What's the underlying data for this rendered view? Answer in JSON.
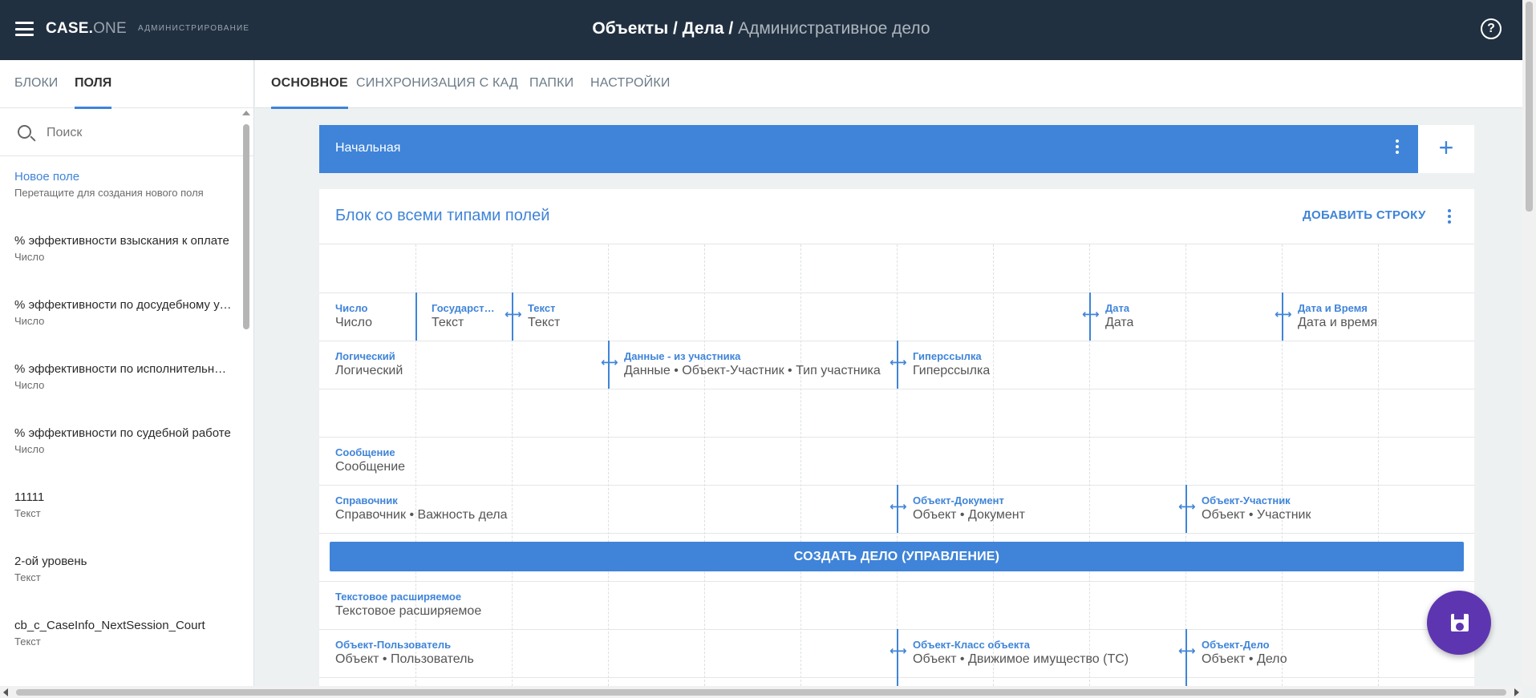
{
  "app": {
    "logo_main": "CASE.",
    "logo_one": "ONE",
    "section": "АДМИНИСТРИРОВАНИЕ",
    "breadcrumb_1": "Объекты",
    "breadcrumb_sep": " / ",
    "breadcrumb_2": "Дела",
    "breadcrumb_current": "Административное дело",
    "help_glyph": "?",
    "menu_icon": "hamburger-icon",
    "help_icon": "help-circle-icon"
  },
  "colors": {
    "topbar": "#213040",
    "accent": "#3f84d8",
    "fab": "#5e35b1"
  },
  "sidebar": {
    "tabs": [
      {
        "label": "БЛОКИ",
        "active": false
      },
      {
        "label": "ПОЛЯ",
        "active": true
      }
    ],
    "search_placeholder": "Поиск",
    "search_value": "",
    "items": [
      {
        "name": "Новое поле",
        "type": "Перетащите для создания нового поля"
      },
      {
        "name": "% эффективности взыскания к оплате",
        "type": "Число"
      },
      {
        "name": "% эффективности по досудебному урегулированию",
        "type": "Число"
      },
      {
        "name": "% эффективности по исполнительному производству",
        "type": "Число"
      },
      {
        "name": "% эффективности по судебной работе",
        "type": "Число"
      },
      {
        "name": "11111",
        "type": "Текст"
      },
      {
        "name": "2-ой уровень",
        "type": "Текст"
      },
      {
        "name": "cb_c_CaseInfo_NextSession_Court",
        "type": "Текст"
      }
    ]
  },
  "content_tabs": [
    {
      "label": "ОСНОВНОЕ",
      "active": true
    },
    {
      "label": "СИНХРОНИЗАЦИЯ С КАД",
      "active": false
    },
    {
      "label": "ПАПКИ",
      "active": false
    },
    {
      "label": "НАСТРОЙКИ",
      "active": false
    }
  ],
  "stage": {
    "label": "Начальная",
    "add_glyph": "+"
  },
  "block": {
    "title": "Блок со всеми типами полей",
    "add_row_label": "ДОБАВИТЬ СТРОКУ",
    "resize_glyph": "⟷",
    "create_button_label": "СОЗДАТЬ ДЕЛО (УПРАВЛЕНИЕ)",
    "fields": [
      {
        "label": "Число",
        "value": "Число"
      },
      {
        "label": "Государственная пошлина",
        "value": "Текст"
      },
      {
        "label": "Текст",
        "value": "Текст"
      },
      {
        "label": "Дата",
        "value": "Дата"
      },
      {
        "label": "Дата и Время",
        "value": "Дата и время"
      },
      {
        "label": "Логический",
        "value": "Логический"
      },
      {
        "label": "Данные - из участника",
        "value": "Данные • Объект-Участник • Тип участника"
      },
      {
        "label": "Гиперссылка",
        "value": "Гиперссылка"
      },
      {
        "label": "Сообщение",
        "value": "Сообщение"
      },
      {
        "label": "Справочник",
        "value": "Справочник • Важность дела"
      },
      {
        "label": "Объект-Документ",
        "value": "Объект • Документ"
      },
      {
        "label": "Объект-Участник",
        "value": "Объект • Участник"
      },
      {
        "label": "Текстовое расширяемое",
        "value": "Текстовое расширяемое"
      },
      {
        "label": "Объект-Пользователь",
        "value": "Объект • Пользователь"
      },
      {
        "label": "Объект-Класс объекта",
        "value": "Объект • Движимое имущество (ТС)"
      },
      {
        "label": "Объект-Дело",
        "value": "Объект • Дело"
      }
    ]
  },
  "fab": {
    "icon": "save-icon"
  }
}
